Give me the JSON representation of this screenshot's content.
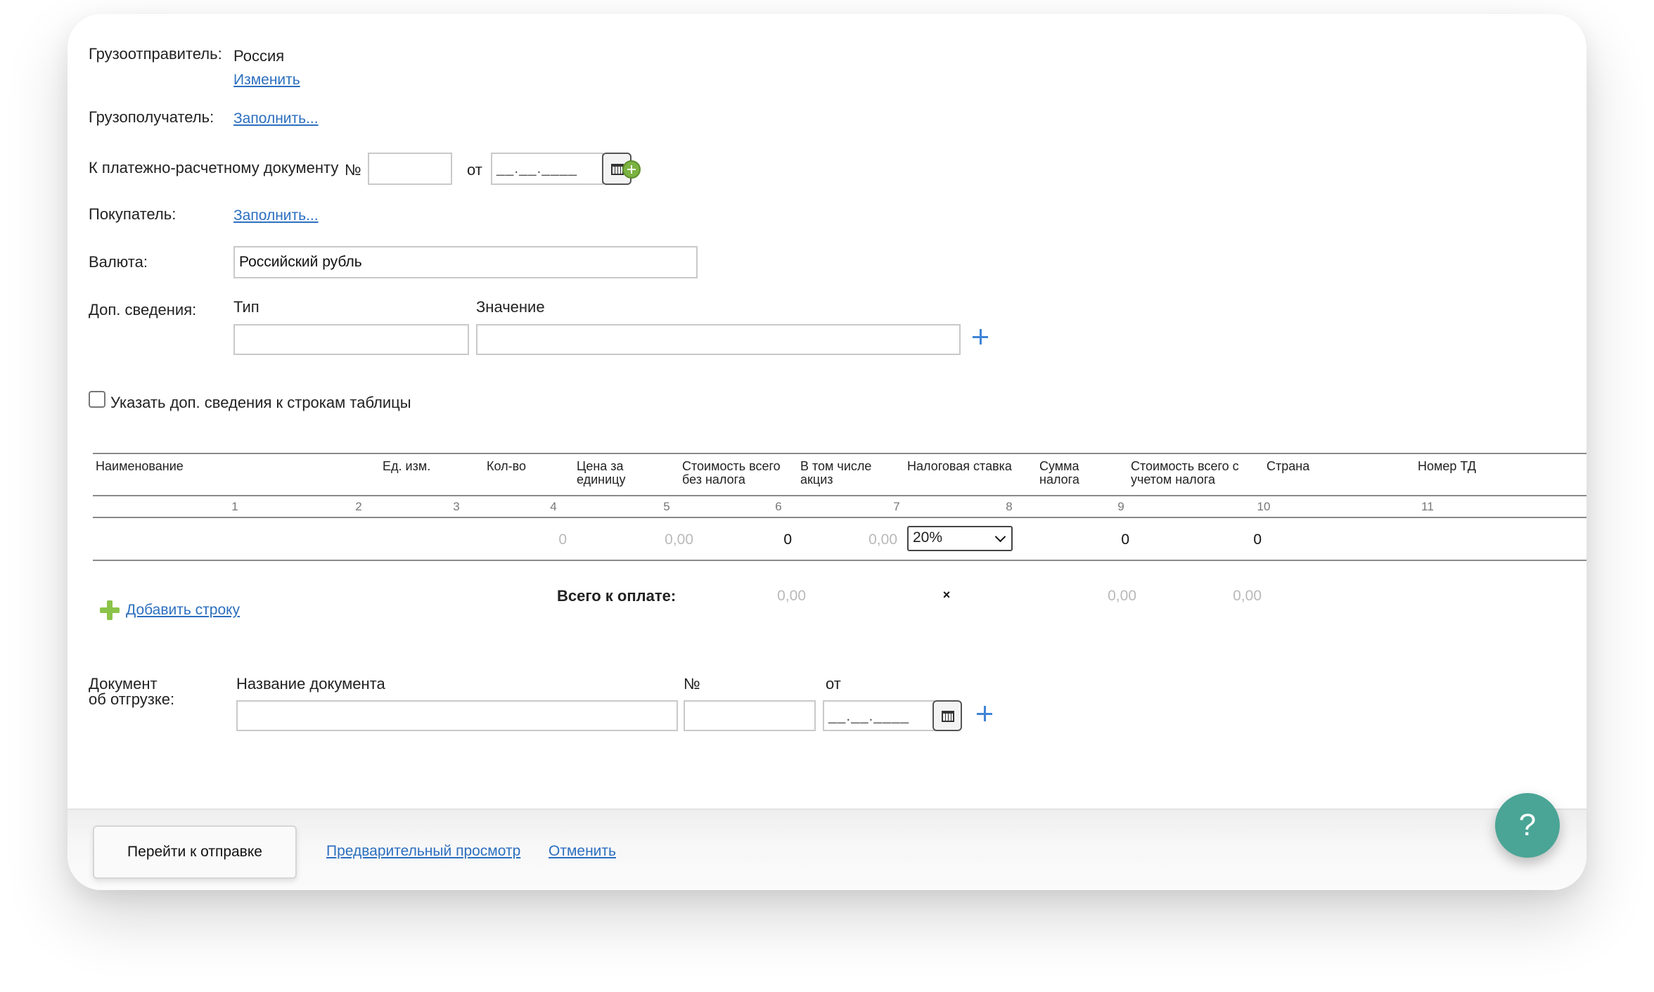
{
  "shipper": {
    "label": "Грузоотправитель:",
    "value": "Россия",
    "change_link": "Изменить"
  },
  "consignee": {
    "label": "Грузополучатель:",
    "fill_link": "Заполнить..."
  },
  "payment_doc": {
    "label": "К платежно-расчетному документу",
    "num_label": "№",
    "num_value": "",
    "from_label": "от",
    "date_mask": "__.__.____"
  },
  "buyer": {
    "label": "Покупатель:",
    "fill_link": "Заполнить..."
  },
  "currency": {
    "label": "Валюта:",
    "value": "Российский рубль"
  },
  "extra_info": {
    "label": "Доп. сведения:",
    "type_label": "Тип",
    "value_label": "Значение",
    "type_value": "",
    "value_value": ""
  },
  "row_extra_checkbox": {
    "label": "Указать доп. сведения к строкам таблицы",
    "checked": false
  },
  "table": {
    "headers": [
      {
        "line1": "Наименование",
        "line2": ""
      },
      {
        "line1": "Ед. изм.",
        "line2": ""
      },
      {
        "line1": "Кол-во",
        "line2": ""
      },
      {
        "line1": "Цена за",
        "line2": "единицу"
      },
      {
        "line1": "Стоимость всего",
        "line2": "без налога"
      },
      {
        "line1": "В том числе",
        "line2": "акциз"
      },
      {
        "line1": "Налоговая ставка",
        "line2": ""
      },
      {
        "line1": "Сумма",
        "line2": "налога"
      },
      {
        "line1": "Стоимость всего с",
        "line2": "учетом налога"
      },
      {
        "line1": "Страна",
        "line2": ""
      },
      {
        "line1": "Номер ТД",
        "line2": ""
      }
    ],
    "col_numbers": [
      "1",
      "2",
      "3",
      "4",
      "5",
      "6",
      "7",
      "8",
      "9",
      "10",
      "11"
    ],
    "row": {
      "qty": "0",
      "price": "0,00",
      "total_no_tax": "0",
      "excise": "0,00",
      "tax_rate": "20%",
      "tax_sum": "0",
      "total_with_tax": "0"
    },
    "totals": {
      "label": "Всего к оплате:",
      "total_no_tax": "0,00",
      "tax_rate": "×",
      "tax_sum": "0,00",
      "total_with_tax": "0,00"
    },
    "add_row_link": "Добавить строку"
  },
  "shipment_doc": {
    "label_line1": "Документ",
    "label_line2": "об отгрузке:",
    "name_label": "Название документа",
    "num_label": "№",
    "from_label": "от",
    "name_value": "",
    "num_value": "",
    "date_mask": "__.__.____"
  },
  "footer": {
    "submit_button": "Перейти к отправке",
    "preview_link": "Предварительный просмотр",
    "cancel_link": "Отменить"
  },
  "help_button": "?",
  "colors": {
    "link": "#2c6fbf",
    "accent_plus": "#3f84d8",
    "green_plus": "#7cb342",
    "help": "#4aa596"
  }
}
